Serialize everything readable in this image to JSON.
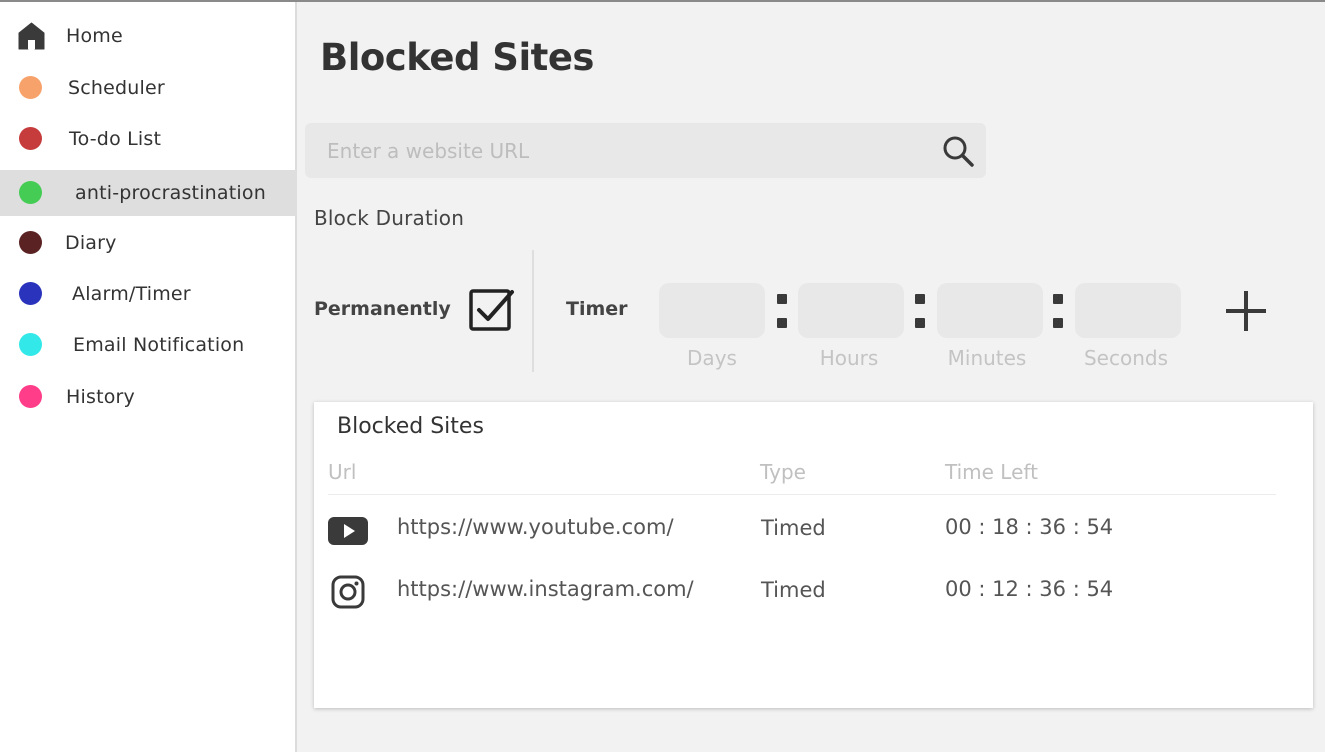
{
  "sidebar": {
    "items": [
      {
        "label": "Home",
        "icon": "home-icon",
        "color": "#3a3a3a"
      },
      {
        "label": "Scheduler",
        "color": "#f7a26b"
      },
      {
        "label": "To-do List",
        "color": "#c63b3b"
      },
      {
        "label": "anti-procrastination",
        "color": "#44cc55",
        "active": true
      },
      {
        "label": "Diary",
        "color": "#5a2222"
      },
      {
        "label": "Alarm/Timer",
        "color": "#2a33bb"
      },
      {
        "label": "Email Notification",
        "color": "#33e8e8"
      },
      {
        "label": "History",
        "color": "#ff3d88"
      }
    ]
  },
  "page": {
    "title": "Blocked Sites"
  },
  "search": {
    "placeholder": "Enter a website URL",
    "value": ""
  },
  "block_duration": {
    "heading": "Block Duration",
    "permanently_label": "Permanently",
    "permanently_checked": true,
    "timer_label": "Timer",
    "fields": [
      "Days",
      "Hours",
      "Minutes",
      "Seconds"
    ]
  },
  "table": {
    "title": "Blocked Sites",
    "columns": [
      "Url",
      "Type",
      "Time Left"
    ],
    "rows": [
      {
        "icon": "youtube-icon",
        "url": "https://www.youtube.com/",
        "type": "Timed",
        "time_left": "00 : 18 : 36 : 54"
      },
      {
        "icon": "instagram-icon",
        "url": "https://www.instagram.com/",
        "type": "Timed",
        "time_left": "00 : 12 : 36 : 54"
      }
    ]
  }
}
